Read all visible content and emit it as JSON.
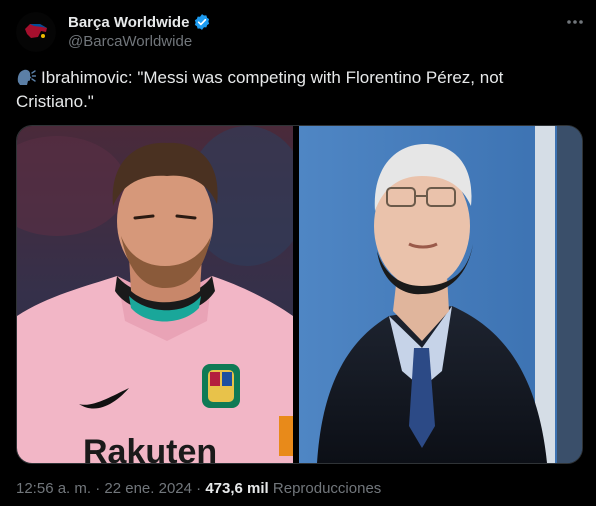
{
  "author": {
    "display_name": "Barça Worldwide",
    "handle": "@BarcaWorldwide",
    "verified": true,
    "avatar_icon": "barca-worldwide-logo"
  },
  "tweet": {
    "emoji_icon": "speaking-head-icon",
    "text": "Ibrahimovic: \"Messi was competing with Florentino Pérez, not Cristiano.\""
  },
  "media": {
    "left_kit_text": "Rakuten"
  },
  "meta": {
    "time": "12:56 a. m.",
    "separator": "·",
    "date": "22 ene. 2024",
    "views_count": "473,6 mil",
    "views_label": "Reproducciones"
  },
  "colors": {
    "background": "#000000",
    "text": "#e7e9ea",
    "secondary": "#71767b",
    "verified": "#1d9bf0",
    "border": "#2f3336"
  }
}
